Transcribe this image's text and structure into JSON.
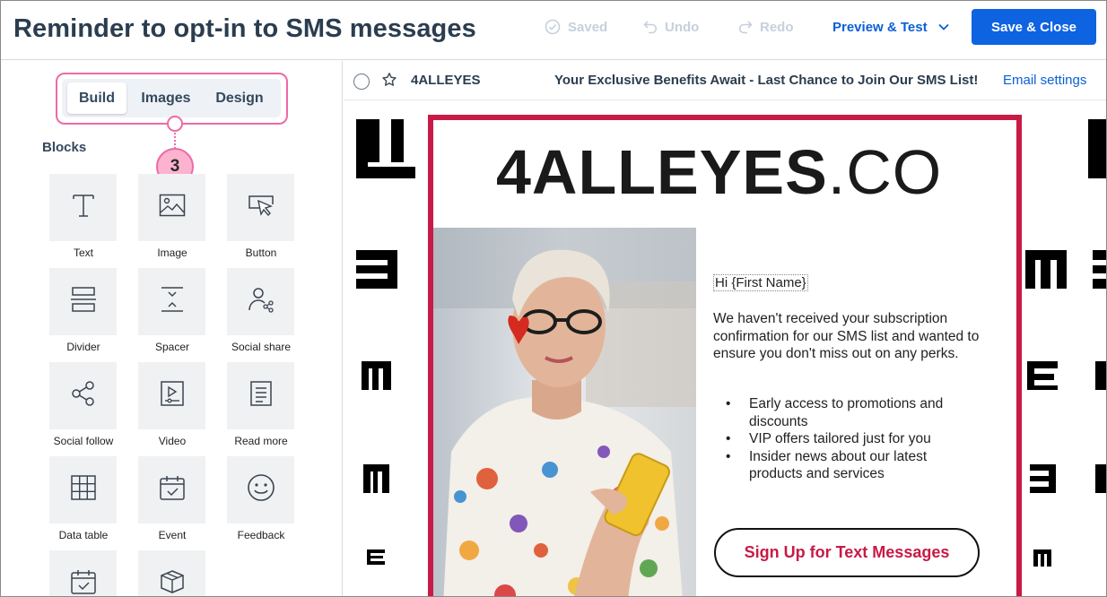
{
  "header": {
    "title": "Reminder to opt-in to SMS messages",
    "saved_label": "Saved",
    "undo_label": "Undo",
    "redo_label": "Redo",
    "preview_label": "Preview & Test",
    "save_close_label": "Save & Close"
  },
  "left_panel": {
    "tabs": [
      {
        "label": "Build",
        "active": true
      },
      {
        "label": "Images",
        "active": false
      },
      {
        "label": "Design",
        "active": false
      }
    ],
    "callout_number": "3",
    "blocks_heading": "Blocks",
    "blocks": [
      {
        "label": "Text",
        "icon": "text-icon"
      },
      {
        "label": "Image",
        "icon": "image-icon"
      },
      {
        "label": "Button",
        "icon": "cursor-click-icon"
      },
      {
        "label": "Divider",
        "icon": "divider-icon"
      },
      {
        "label": "Spacer",
        "icon": "spacer-icon"
      },
      {
        "label": "Social share",
        "icon": "social-share-icon"
      },
      {
        "label": "Social follow",
        "icon": "share-network-icon"
      },
      {
        "label": "Video",
        "icon": "video-icon"
      },
      {
        "label": "Read more",
        "icon": "document-icon"
      },
      {
        "label": "Data table",
        "icon": "table-grid-icon"
      },
      {
        "label": "Event",
        "icon": "calendar-check-icon"
      },
      {
        "label": "Feedback",
        "icon": "smiley-icon"
      },
      {
        "label": "",
        "icon": "calendar-icon"
      },
      {
        "label": "",
        "icon": "box-icon"
      }
    ]
  },
  "email_bar": {
    "sender": "4ALLEYES",
    "subject": "Your Exclusive Benefits Await - Last Chance to Join Our SMS List!",
    "settings_link": "Email settings"
  },
  "email": {
    "logo_bold": "4ALLEYES",
    "logo_thin": ".CO",
    "greeting": "Hi {First Name}",
    "body": "We haven't received your subscription confirmation for our SMS list and wanted to ensure you don't miss out on any perks.",
    "bullets": [
      "Early access to promotions and discounts",
      "VIP offers tailored just for you",
      "Insider news about our latest products and services"
    ],
    "cta_label": "Sign Up for Text Messages"
  },
  "colors": {
    "accent_blue": "#0e63e1",
    "link_blue": "#0a5fd6",
    "highlight_pink": "#ee6aa6",
    "brand_crimson": "#c81a46"
  }
}
